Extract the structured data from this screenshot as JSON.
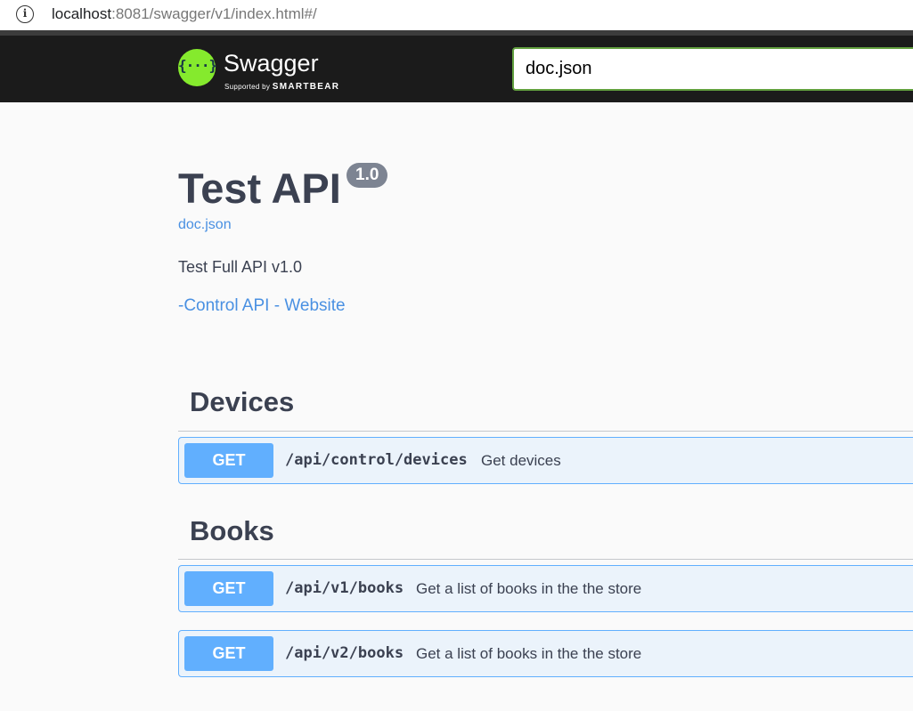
{
  "browser": {
    "url_host": "localhost",
    "url_rest": ":8081/swagger/v1/index.html#/"
  },
  "topbar": {
    "logo_text": "Swagger",
    "logo_glyph": "{···}",
    "supported_by": "Supported by",
    "smartbear": "SMARTBEAR",
    "definition_input": "doc.json"
  },
  "info": {
    "title": "Test API",
    "version": "1.0",
    "doc_link": "doc.json",
    "description": "Test Full API v1.0",
    "website_link": "-Control API - Website"
  },
  "tags": [
    {
      "name": "Devices",
      "operations": [
        {
          "method": "GET",
          "path": "/api/control/devices",
          "summary": "Get devices"
        }
      ]
    },
    {
      "name": "Books",
      "operations": [
        {
          "method": "GET",
          "path": "/api/v1/books",
          "summary": "Get a list of books in the the store"
        },
        {
          "method": "GET",
          "path": "/api/v2/books",
          "summary": "Get a list of books in the the store"
        }
      ]
    }
  ],
  "colors": {
    "get_method": "#61affe",
    "get_bg": "#ebf3fb",
    "logo_green": "#85ea2d",
    "link": "#4990e2"
  }
}
